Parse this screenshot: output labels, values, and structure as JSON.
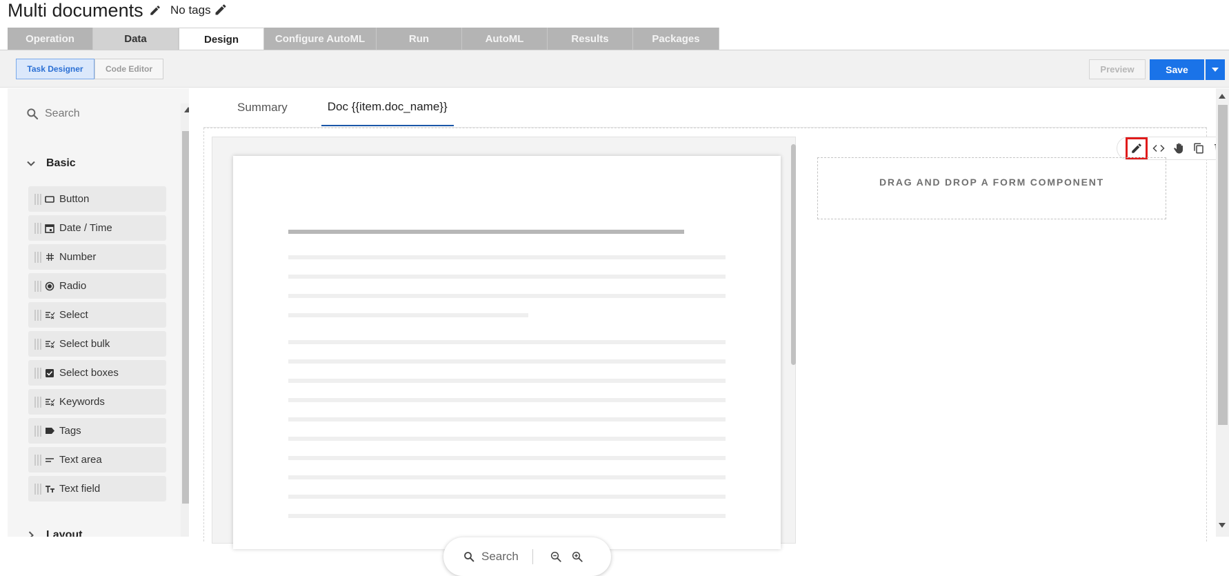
{
  "header": {
    "title": "Multi documents",
    "tags": "No tags"
  },
  "main_tabs": [
    {
      "label": "Operation"
    },
    {
      "label": "Data"
    },
    {
      "label": "Design"
    },
    {
      "label": "Configure AutoML"
    },
    {
      "label": "Run"
    },
    {
      "label": "AutoML"
    },
    {
      "label": "Results"
    },
    {
      "label": "Packages"
    }
  ],
  "toolbar": {
    "task_designer": "Task Designer",
    "code_editor": "Code Editor",
    "preview": "Preview",
    "save": "Save"
  },
  "palette": {
    "search_placeholder": "Search",
    "group_basic": "Basic",
    "group_layout": "Layout",
    "components": [
      {
        "label": "Button",
        "icon": "button-icon"
      },
      {
        "label": "Date / Time",
        "icon": "calendar-icon"
      },
      {
        "label": "Number",
        "icon": "hash-icon"
      },
      {
        "label": "Radio",
        "icon": "radio-icon"
      },
      {
        "label": "Select",
        "icon": "select-icon"
      },
      {
        "label": "Select bulk",
        "icon": "select-bulk-icon"
      },
      {
        "label": "Select boxes",
        "icon": "checkbox-icon"
      },
      {
        "label": "Keywords",
        "icon": "keywords-icon"
      },
      {
        "label": "Tags",
        "icon": "tag-icon"
      },
      {
        "label": "Text area",
        "icon": "text-area-icon"
      },
      {
        "label": "Text field",
        "icon": "text-field-icon"
      }
    ]
  },
  "canvas": {
    "tabs": [
      {
        "label": "Summary"
      },
      {
        "label": "Doc {{item.doc_name}}"
      }
    ],
    "viewer": {
      "search_label": "Search"
    },
    "drop_zone_text": "DRAG AND DROP A FORM COMPONENT"
  },
  "colors": {
    "primary": "#1a73e8",
    "highlight": "#e01b1b",
    "tab_inactive": "#b4b4b4"
  }
}
